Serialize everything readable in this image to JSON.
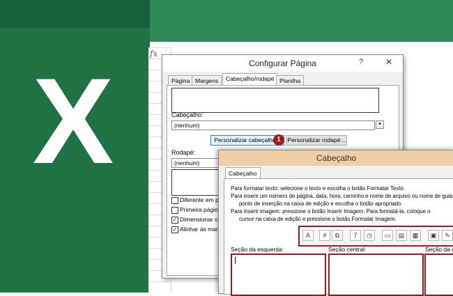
{
  "background": {
    "logo_letter": "X",
    "formula_icon": "fx",
    "colors": {
      "excel_green": "#1f7244",
      "accent_red": "#9b1c1f",
      "title_orange": "#f1cfa6"
    }
  },
  "page_setup": {
    "title": "Configurar Página",
    "help": "?",
    "close": "✕",
    "tabs": [
      "Página",
      "Margens",
      "Cabeçalho/rodapé",
      "Planilha"
    ],
    "active_tab": "Cabeçalho/rodapé",
    "header_label": "Cabeçalho:",
    "header_value": "(nenhum)",
    "custom_header_button": "Personalizar cabeçalho...",
    "custom_footer_button": "Personalizar rodapé...",
    "step_badge": "1",
    "footer_label": "Rodapé:",
    "footer_value": "(nenhum)",
    "options": [
      {
        "label": "Diferente em pág",
        "checked": false
      },
      {
        "label": "Primeira página d",
        "checked": false
      },
      {
        "label": "Dimensionar com",
        "checked": true
      },
      {
        "label": "Alinhar às marge",
        "checked": true
      }
    ]
  },
  "header_dialog": {
    "title": "Cabeçalho",
    "tab": "Cabeçalho",
    "instructions": [
      "Para formatar texto: selecione o texto e escolha o botão Formatar Texto.",
      "Para inserir um número de página, data, hora, caminho e nome de arquivo ou nome de guia: p",
      "ponto de inserção na caixa de edição e escolha o botão apropriado.",
      "Para inserir imagem: pressione o botão Inserir Imagem. Para formatá-la, coloque o",
      "cursor na caixa de edição e pressione o botão Formatar Imagem."
    ],
    "toolbar_icons": [
      {
        "name": "format-text-icon",
        "glyph": "A"
      },
      {
        "name": "page-number-icon",
        "glyph": "#"
      },
      {
        "name": "number-of-pages-icon",
        "glyph": "⧉"
      },
      {
        "name": "date-icon",
        "glyph": "7"
      },
      {
        "name": "time-icon",
        "glyph": "◷"
      },
      {
        "name": "file-path-icon",
        "glyph": "▭"
      },
      {
        "name": "file-name-icon",
        "glyph": "▤"
      },
      {
        "name": "sheet-name-icon",
        "glyph": "▦"
      },
      {
        "name": "insert-picture-icon",
        "glyph": "▣"
      },
      {
        "name": "format-picture-icon",
        "glyph": "✎"
      }
    ],
    "left_section_label": "Seção da esquerda:",
    "center_section_label": "Seção central:",
    "right_section_label": "Seção da di"
  }
}
